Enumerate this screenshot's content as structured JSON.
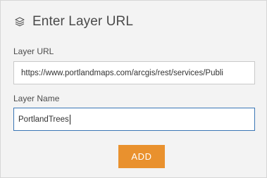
{
  "header": {
    "icon": "layers-icon",
    "title": "Enter Layer URL"
  },
  "form": {
    "url_label": "Layer URL",
    "url_value": "https://www.portlandmaps.com/arcgis/rest/services/Publi",
    "name_label": "Layer Name",
    "name_value": "PortlandTrees"
  },
  "actions": {
    "add_label": "ADD"
  },
  "colors": {
    "panel_bg": "#f3f3f3",
    "accent": "#e9912e",
    "focus_border": "#3a76b5"
  }
}
